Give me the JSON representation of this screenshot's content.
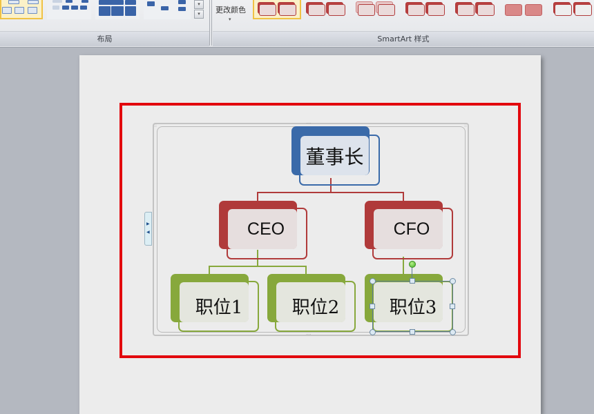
{
  "ribbon": {
    "groups": [
      {
        "id": "layout",
        "label": "布局"
      },
      {
        "id": "smartart_styles",
        "label": "SmartArt 样式"
      }
    ],
    "change_color": {
      "label": "更改颜色",
      "arrow": "▾"
    },
    "gallery_scroll": {
      "up": "▾",
      "more": "▾"
    }
  },
  "diagram": {
    "colors": {
      "blue": "#3a6aa9",
      "red": "#b03a3a",
      "green": "#87a83c",
      "highlight": "#e2060d"
    },
    "nodes": {
      "chairman": {
        "text": "董事长"
      },
      "ceo": {
        "text": "CEO"
      },
      "cfo": {
        "text": "CFO"
      },
      "pos1": {
        "text": "职位1"
      },
      "pos2": {
        "text": "职位2"
      },
      "pos3": {
        "text": "职位3"
      }
    },
    "selected_node": "pos3"
  },
  "text_pane_toggle": {
    "expand": "▶",
    "collapse": "◀"
  }
}
